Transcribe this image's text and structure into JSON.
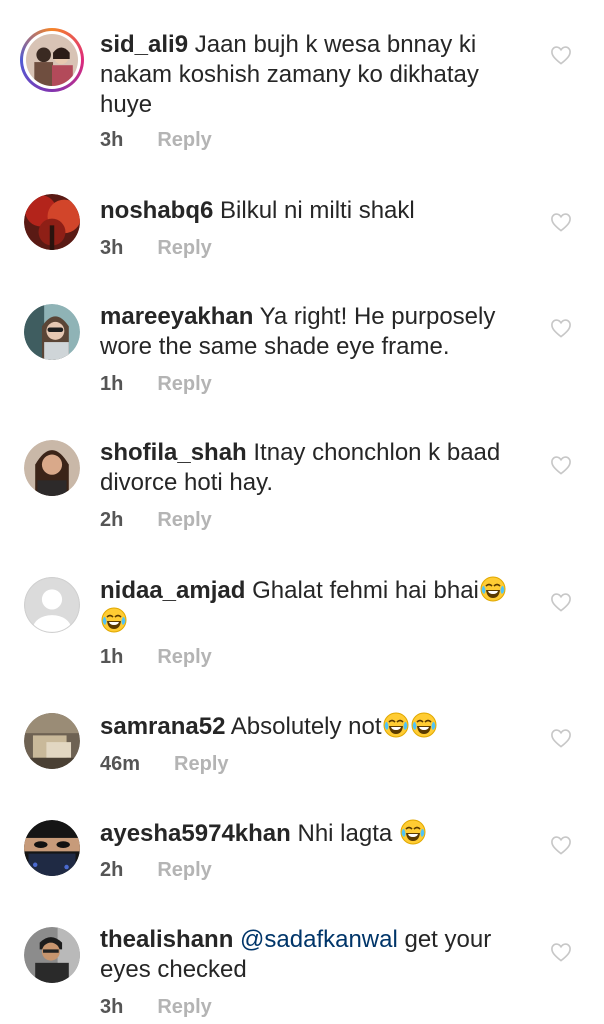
{
  "comments": [
    {
      "username": "sid_ali9",
      "text": "Jaan bujh k wesa bnnay ki nakam koshish zamany ko dikhatay huye",
      "time": "3h",
      "reply": "Reply"
    },
    {
      "username": "noshabq6",
      "text": "Bilkul ni milti shakl",
      "time": "3h",
      "reply": "Reply"
    },
    {
      "username": "mareeyakhan",
      "text": "Ya right! He purposely wore the same shade eye frame.",
      "time": "1h",
      "reply": "Reply"
    },
    {
      "username": "shofila_shah",
      "text": "Itnay chonchlon k baad divorce hoti hay.",
      "time": "2h",
      "reply": "Reply"
    },
    {
      "username": "nidaa_amjad",
      "text": "Ghalat fehmi hai bhai",
      "time": "1h",
      "reply": "Reply",
      "emoji": "face-with-tears-of-joy"
    },
    {
      "username": "samrana52",
      "text": "Absolutely not",
      "time": "46m",
      "reply": "Reply",
      "emoji": "face-with-tears-of-joy"
    },
    {
      "username": "ayesha5974khan",
      "text": "Nhi lagta",
      "time": "2h",
      "reply": "Reply",
      "emoji": "face-with-tears-of-joy"
    },
    {
      "username": "thealishann",
      "mention": "@sadafkanwal",
      "text": "get your eyes checked",
      "time": "3h",
      "reply": "Reply"
    }
  ],
  "colors": {
    "text": "#262626",
    "time": "#555555",
    "reply": "#b4b4b4",
    "mention": "#003569",
    "heart": "#c7c7c7"
  },
  "icons": {
    "like": "heart-outline-icon",
    "emoji": "face-with-tears-of-joy"
  }
}
